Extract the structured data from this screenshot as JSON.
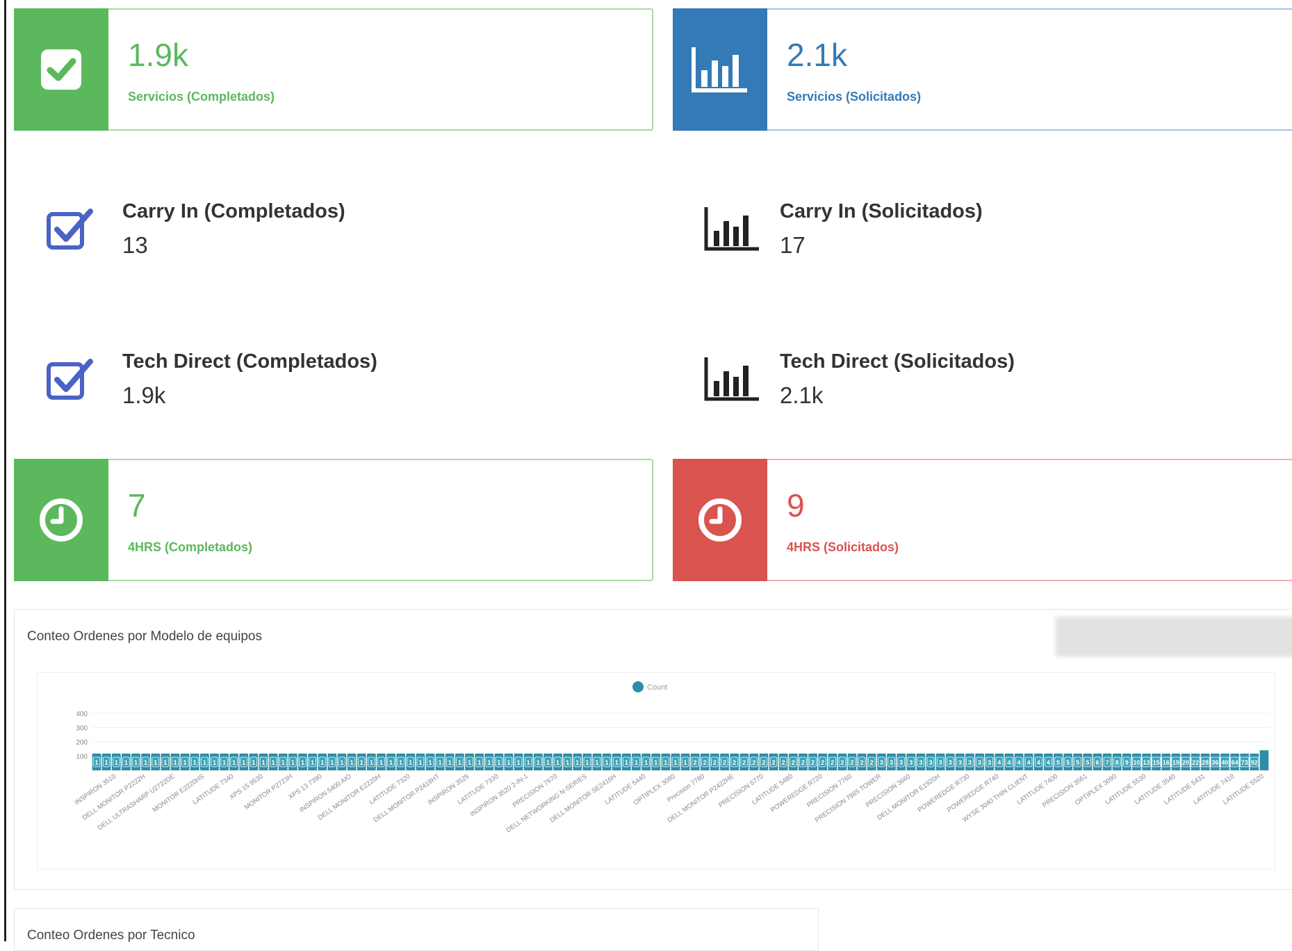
{
  "colors": {
    "green": "#5cb85c",
    "blue": "#337ab7",
    "red": "#d9534f",
    "stat_icon_blue": "#4a63c4",
    "bar": "#2a8fa6"
  },
  "info_boxes": [
    {
      "value": "1.9k",
      "label": "Servicios (Completados)",
      "icon": "check-square-icon",
      "color": "green"
    },
    {
      "value": "2.1k",
      "label": "Servicios (Solicitados)",
      "icon": "bar-chart-icon",
      "color": "blue"
    },
    {
      "value": "7",
      "label": "4HRS (Completados)",
      "icon": "clock-icon",
      "color": "green"
    },
    {
      "value": "9",
      "label": "4HRS (Solicitados)",
      "icon": "clock-icon",
      "color": "red"
    }
  ],
  "stats": [
    {
      "title": "Carry In (Completados)",
      "value": "13",
      "icon": "check-square-icon"
    },
    {
      "title": "Carry In (Solicitados)",
      "value": "17",
      "icon": "bar-chart-icon"
    },
    {
      "title": "Tech Direct (Completados)",
      "value": "1.9k",
      "icon": "check-square-icon"
    },
    {
      "title": "Tech Direct (Solicitados)",
      "value": "2.1k",
      "icon": "bar-chart-icon"
    }
  ],
  "chart_panel": {
    "title": "Conteo Ordenes por Modelo de equipos"
  },
  "tech_panel": {
    "title": "Conteo Ordenes por Tecnico"
  },
  "chart_data": {
    "type": "bar",
    "legend": "Count",
    "legend_position": "top-center",
    "ylim": [
      0,
      400
    ],
    "yticks": [
      100,
      200,
      300,
      400
    ],
    "categories": [
      "INSPIRON 3510",
      "DELL MONITOR P2222H",
      "DELL ULTRASHARP U2722DE",
      "MONITOR E2220HS",
      "LATITUDE 7340",
      "XPS 15 9530",
      "MONITOR P2723H",
      "XPS 13 7390",
      "INSPIRON 5400 AIO",
      "DELL MONITOR E2220H",
      "LATITUDE 7320",
      "DELL MONITOR P2418HT",
      "INSPIRON 3525",
      "LATITUDE 7330",
      "INSPIRON 3520 2-IN-1",
      "PRECISION 7670",
      "DELL NETWORKING N-SERIES",
      "DELL MONITOR SE2416H",
      "LATITUDE 5440",
      "OPTIPLEX 3080",
      "Precision 7780",
      "DELL MONITOR P2422HE",
      "PRECISION 5770",
      "LATITUDE 5480",
      "POWEREDGE R720",
      "PRECISION 7760",
      "PRECISION 7865 TOWER",
      "PRECISION 3660",
      "DELL MONITOR E1920H",
      "POWEREDGE R730",
      "POWEREDGE R740",
      "WYSE 3040 THIN CLIENT",
      "LATITUDE 7400",
      "PRECISION 3561",
      "OPTIPLEX 3090",
      "LATITUDE 5530",
      "LATITUDE 3540",
      "LATITUDE 5431",
      "LATITUDE 7410",
      "LATITUDE 5520"
    ],
    "values": [
      1,
      1,
      1,
      1,
      1,
      1,
      1,
      1,
      1,
      1,
      1,
      1,
      1,
      1,
      1,
      1,
      1,
      1,
      1,
      1,
      1,
      1,
      1,
      1,
      1,
      1,
      1,
      1,
      1,
      1,
      1,
      1,
      1,
      1,
      1,
      1,
      1,
      1,
      1,
      1,
      1,
      1,
      1,
      1,
      1,
      1,
      1,
      1,
      1,
      1,
      1,
      1,
      1,
      1,
      1,
      1,
      1,
      1,
      1,
      1,
      1,
      2,
      2,
      2,
      2,
      2,
      2,
      2,
      2,
      2,
      2,
      2,
      2,
      2,
      2,
      2,
      2,
      2,
      2,
      2,
      3,
      3,
      3,
      3,
      3,
      3,
      3,
      3,
      3,
      3,
      3,
      3,
      4,
      4,
      4,
      4,
      4,
      4,
      5,
      5,
      5,
      5,
      6,
      7,
      8,
      9,
      10,
      13,
      15,
      16,
      19,
      20,
      22,
      28,
      36,
      40,
      64,
      73,
      92,
      140
    ],
    "labels": [
      "1",
      "1",
      "1",
      "1",
      "1",
      "1",
      "1",
      "1",
      "1",
      "1",
      "1",
      "1",
      "1",
      "1",
      "1",
      "1",
      "1",
      "1",
      "1",
      "1",
      "1",
      "1",
      "1",
      "1",
      "1",
      "1",
      "1",
      "1",
      "1",
      "1",
      "1",
      "1",
      "1",
      "1",
      "1",
      "1",
      "1",
      "1",
      "1",
      "1",
      "1",
      "1",
      "1",
      "1",
      "1",
      "1",
      "1",
      "1",
      "1",
      "1",
      "1",
      "1",
      "1",
      "1",
      "1",
      "1",
      "1",
      "1",
      "1",
      "1",
      "1",
      "2",
      "2",
      "2",
      "2",
      "2",
      "2",
      "2",
      "2",
      "2",
      "2",
      "2",
      "2",
      "2",
      "2",
      "2",
      "2",
      "2",
      "2",
      "2",
      "3",
      "3",
      "3",
      "3",
      "3",
      "3",
      "3",
      "3",
      "3",
      "3",
      "3",
      "3",
      "4",
      "4",
      "4",
      "4",
      "4",
      "4",
      "5",
      "5",
      "5",
      "5",
      "6",
      "7",
      "8",
      "9",
      "10",
      "13",
      "15",
      "16",
      "19",
      "20",
      "22",
      "28",
      "36",
      "40",
      "64",
      "73",
      "92",
      ""
    ]
  }
}
